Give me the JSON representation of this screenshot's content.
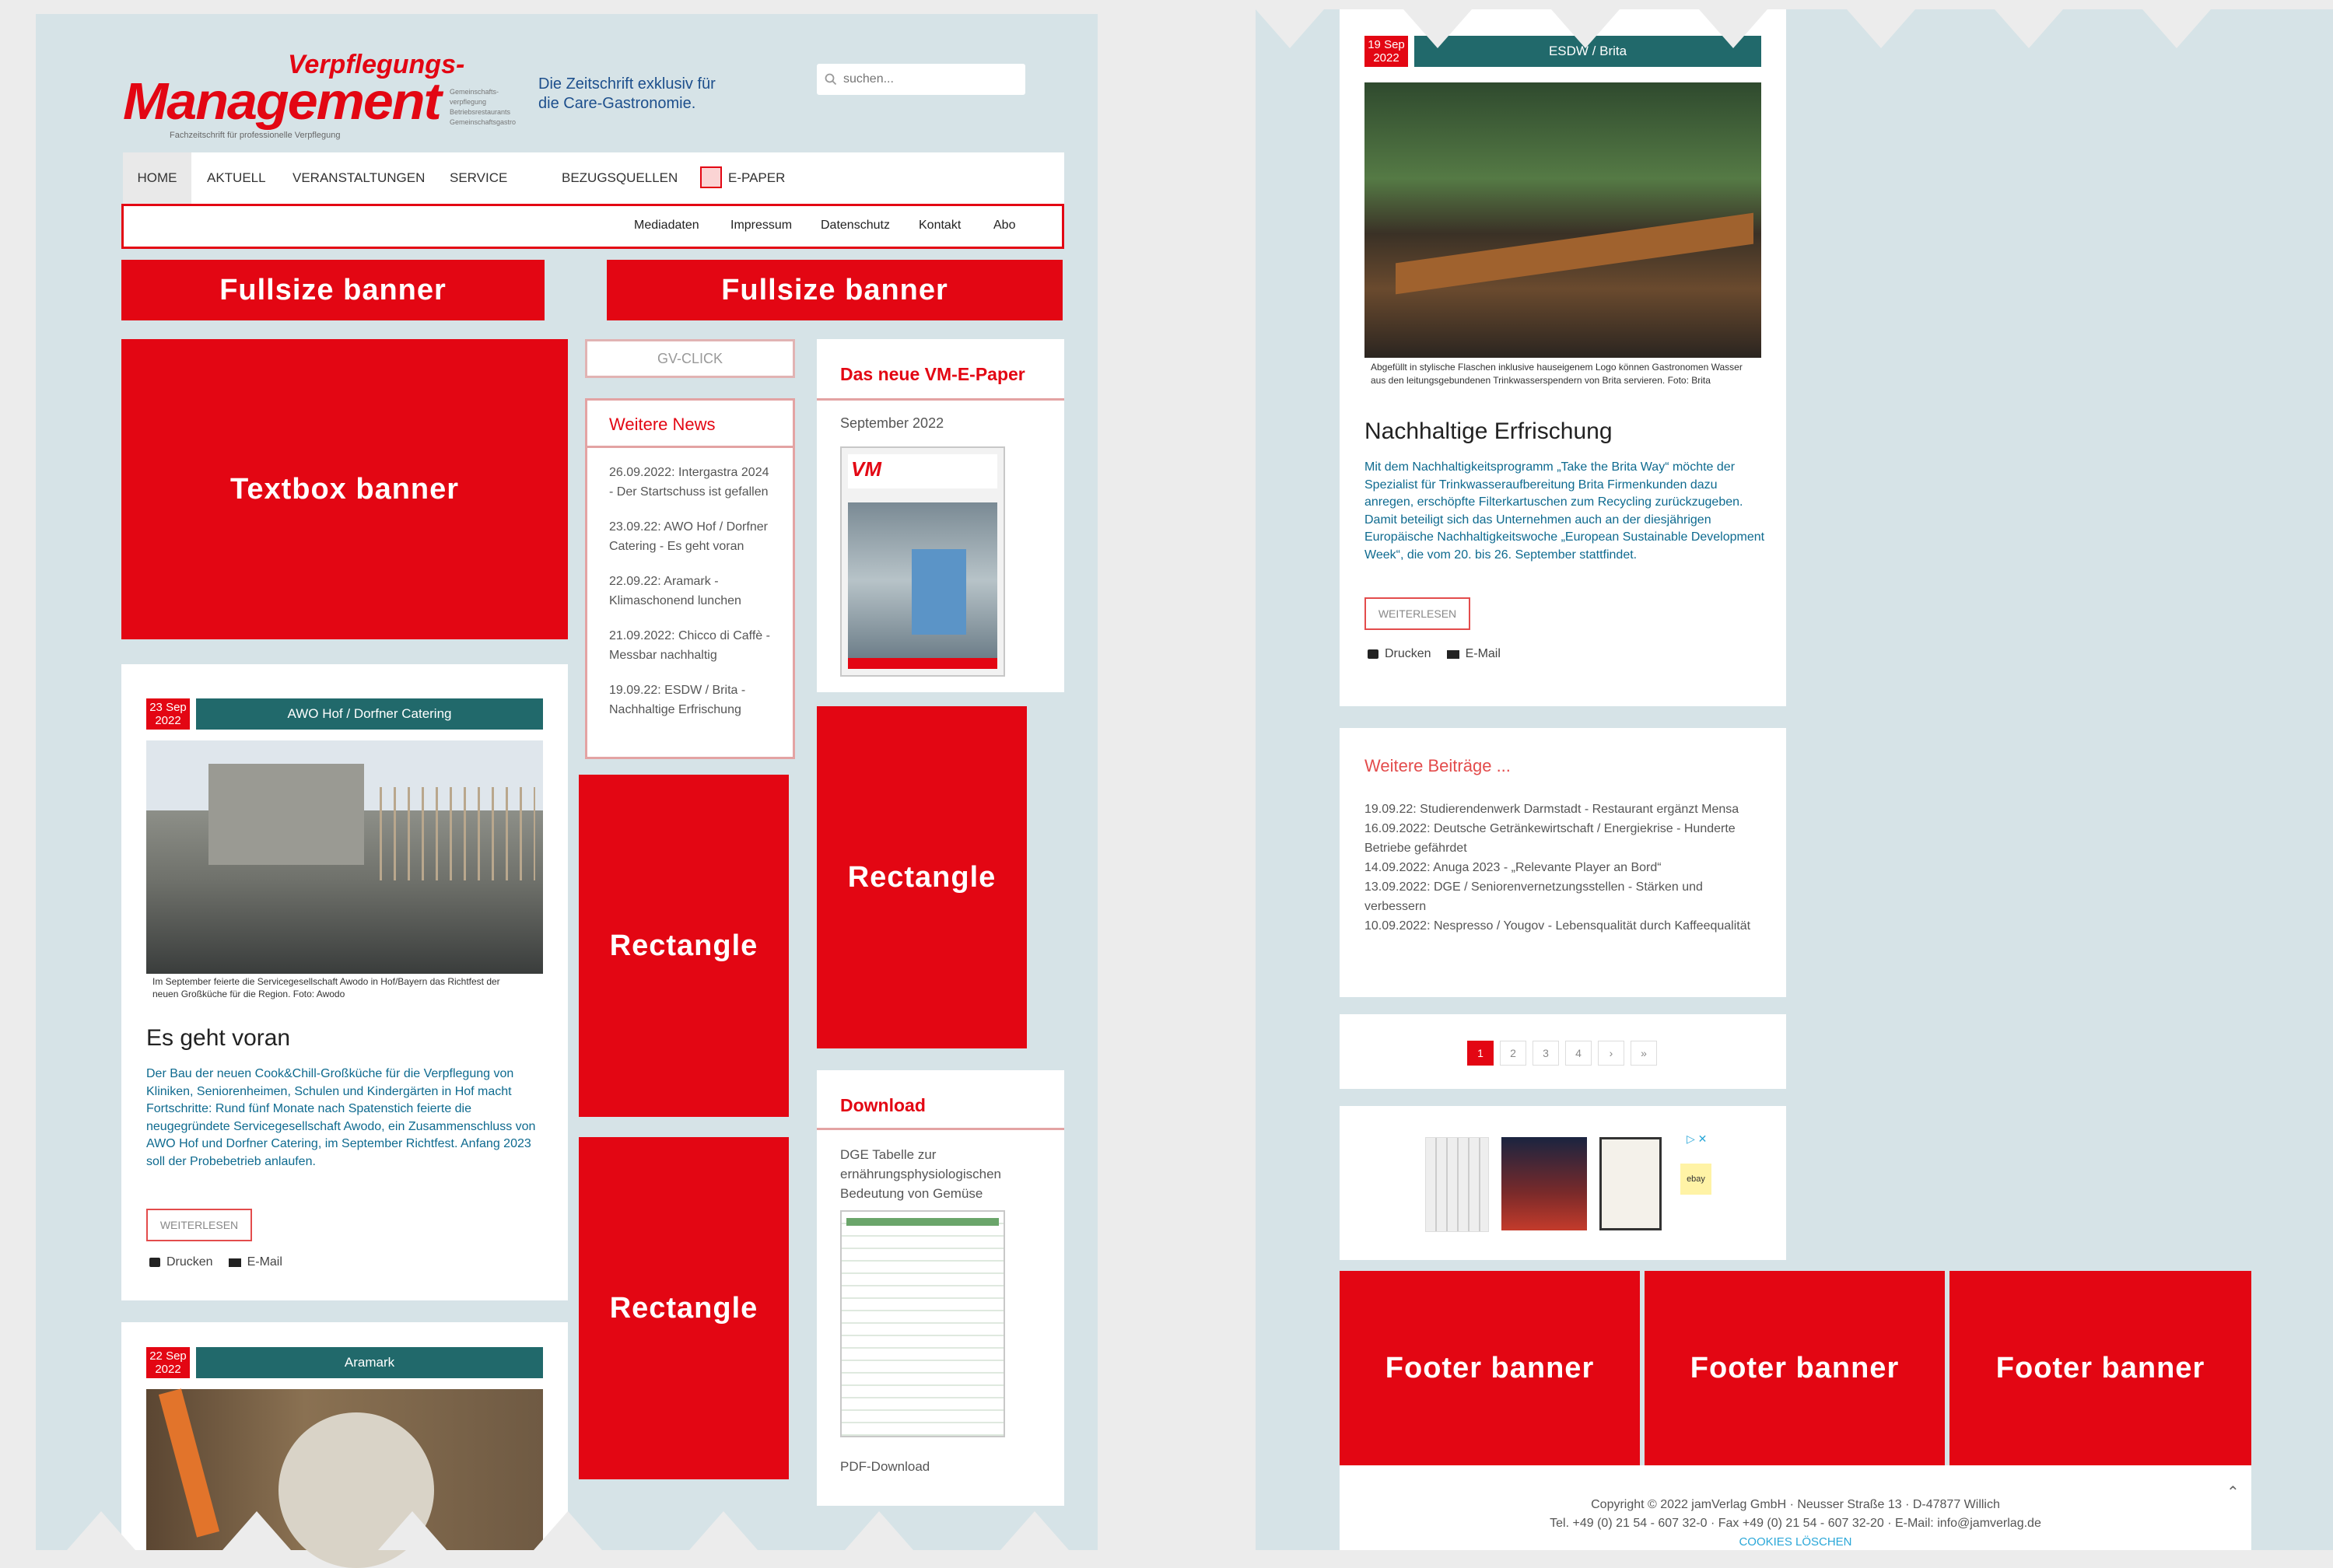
{
  "brand": {
    "title_line1": "Verpflegungs-",
    "title_line2": "Management",
    "tagline_small": "Fachzeitschrift für professionelle Verpflegung",
    "side_text": [
      "Gemeinschafts-",
      "verpflegung",
      "Betriebsrestaurants",
      "Gemeinschaftsgastro"
    ],
    "slogan_line1": "Die Zeitschrift exklusiv für",
    "slogan_line2": "die Care-Gastronomie."
  },
  "search": {
    "placeholder": "suchen..."
  },
  "nav": {
    "items": [
      "HOME",
      "AKTUELL",
      "VERANSTALTUNGEN",
      "SERVICE",
      "BEZUGSQUELLEN",
      "E-PAPER"
    ],
    "sub_items": [
      "Mediadaten",
      "Impressum",
      "Datenschutz",
      "Kontakt",
      "Abo"
    ]
  },
  "banners": {
    "fullsize": "Fullsize banner",
    "textbox": "Textbox banner",
    "rectangle": "Rectangle",
    "footer": "Footer banner"
  },
  "sidebar": {
    "gv_click": "GV-CLICK",
    "news_title": "Weitere News",
    "news": [
      "26.09.2022: Intergastra 2024 - Der Startschuss ist gefallen",
      "23.09.22: AWO Hof / Dorfner Catering - Es geht voran",
      "22.09.22: Aramark - Klimaschonend lunchen",
      "21.09.2022: Chicco di Caffè - Messbar nachhaltig",
      "19.09.22: ESDW / Brita - Nachhaltige Erfrischung"
    ],
    "epaper_title": "Das neue VM-E-Paper",
    "epaper_date": "September 2022",
    "download_title": "Download",
    "download_text": "DGE Tabelle zur ernährungsphysiologischen Bedeutung von Gemüse",
    "download_link": "PDF-Download"
  },
  "article1": {
    "date_day": "23 Sep",
    "date_year": "2022",
    "category": "AWO Hof / Dorfner Catering",
    "caption": "Im September feierte die Servicegesellschaft Awodo in Hof/Bayern das Richtfest der neuen Großküche für die Region. Foto: Awodo",
    "headline": "Es geht voran",
    "body": "Der Bau der neuen Cook&Chill-Großküche für die Verpflegung von Kliniken, Seniorenheimen, Schulen und Kindergärten in Hof macht Fortschritte: Rund fünf Monate nach Spatenstich feierte die neugegründete Servicegesellschaft Awodo, ein Zusammenschluss von AWO Hof und Dorfner Catering, im September Richtfest. Anfang 2023 soll der Probebetrieb anlaufen.",
    "readmore": "WEITERLESEN",
    "print": "Drucken",
    "email": "E-Mail"
  },
  "article2": {
    "date_day": "22 Sep",
    "date_year": "2022",
    "category": "Aramark"
  },
  "article3": {
    "date_day": "19 Sep",
    "date_year": "2022",
    "category": "ESDW / Brita",
    "caption": "Abgefüllt in stylische Flaschen inklusive hauseigenem Logo können Gastronomen Wasser aus den leitungsgebundenen Trinkwasserspendern von Brita servieren. Foto: Brita",
    "headline": "Nachhaltige Erfrischung",
    "body": "Mit dem Nachhaltigkeitsprogramm „Take the Brita Way“ möchte der Spezialist für Trinkwasseraufbereitung Brita Firmenkunden dazu anregen, erschöpfte Filterkartuschen zum Recycling zurückzugeben. Damit beteiligt sich das Unternehmen auch an der diesjährigen Europäische Nachhaltigkeitswoche „European Sustainable Development Week“, die vom 20. bis 26. September stattfindet.",
    "readmore": "WEITERLESEN",
    "print": "Drucken",
    "email": "E-Mail"
  },
  "more_posts": {
    "title": "Weitere Beiträge ...",
    "items": [
      "19.09.22: Studierendenwerk Darmstadt - Restaurant ergänzt Mensa",
      "16.09.2022: Deutsche Getränkewirtschaft / Energiekrise - Hunderte Betriebe gefährdet",
      "14.09.2022: Anuga 2023 - „Relevante Player an Bord“",
      "13.09.2022: DGE / Seniorenvernetzungsstellen - Stärken und verbessern",
      "10.09.2022: Nespresso / Yougov - Lebensqualität durch Kaffeequalität"
    ]
  },
  "pagination": [
    "1",
    "2",
    "3",
    "4",
    "›",
    "»"
  ],
  "ad": {
    "badge": "ebay"
  },
  "footer": {
    "copyright": "Copyright © 2022 jamVerlag GmbH · Neusser Straße 13 · D-47877 Willich",
    "contact": "Tel. +49 (0) 21 54 - 607 32-0 · Fax +49 (0) 21 54 - 607 32-20 · E-Mail: info@jamverlag.de",
    "cookies": "COOKIES LÖSCHEN"
  },
  "colors": {
    "accent": "#e30613",
    "teal": "#21696b",
    "panel": "#d6e3e7"
  }
}
